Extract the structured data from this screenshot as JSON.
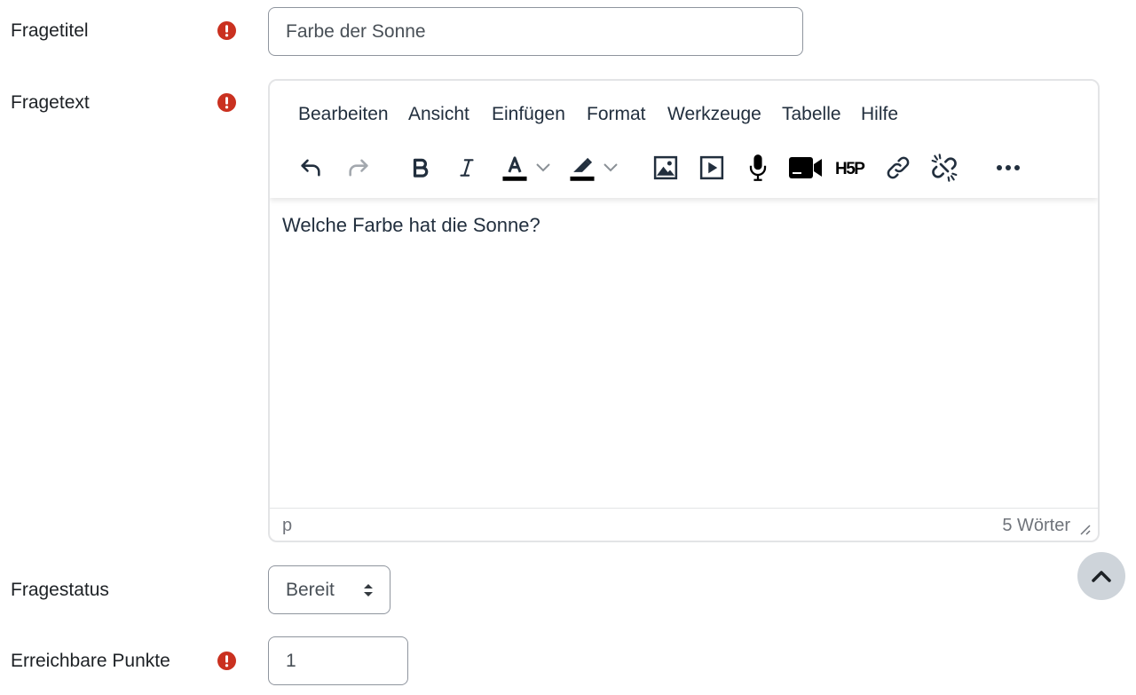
{
  "fields": {
    "title": {
      "label": "Fragetitel",
      "value": "Farbe der Sonne"
    },
    "text": {
      "label": "Fragetext"
    },
    "status": {
      "label": "Fragestatus",
      "value": "Bereit"
    },
    "points": {
      "label": "Erreichbare Punkte",
      "value": "1"
    }
  },
  "editor": {
    "menubar": [
      "Bearbeiten",
      "Ansicht",
      "Einfügen",
      "Format",
      "Werkzeuge",
      "Tabelle",
      "Hilfe"
    ],
    "toolbar_icons": [
      "undo-icon",
      "redo-icon",
      "bold-icon",
      "italic-icon",
      "text-color-icon",
      "highlight-color-icon",
      "image-icon",
      "media-icon",
      "record-audio-icon",
      "record-video-icon",
      "h5p-icon",
      "link-icon",
      "unlink-icon",
      "more-icon"
    ],
    "h5p_label": "H5P",
    "content": "Welche Farbe hat die Sonne?",
    "statusbar": {
      "path": "p",
      "wordcount": "5 Wörter"
    }
  },
  "colors": {
    "required": "#ca3120",
    "text": "#1d2125",
    "border": "#8f959e",
    "toolbar_icon": "#222f3e",
    "back_to_top_bg": "#ced4da"
  }
}
